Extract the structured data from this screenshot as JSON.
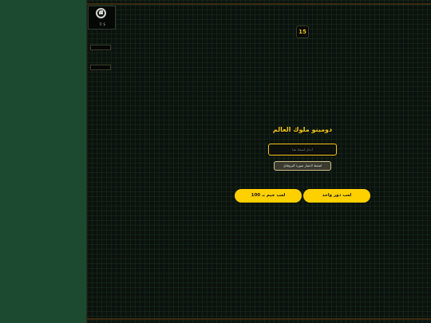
{
  "game": {
    "title": "دومينو ملوك العالم",
    "name_placeholder": "أدخل اسمك هنا",
    "profile_button_label": "اضغط لاختيار صورة البروفايل",
    "play_coins_button_label": "لعب جيم بـ 100",
    "play_single_button_label": "لعب دور واحد",
    "timer_value": "15"
  },
  "side_panel": {
    "avatar_label": "0 $",
    "button_1_label": "",
    "button_2_label": ""
  },
  "colors": {
    "accent": "#f2c418",
    "button_yellow": "#ffd000",
    "left_panel": "#1b4a30",
    "board_bg": "#0b120d"
  }
}
